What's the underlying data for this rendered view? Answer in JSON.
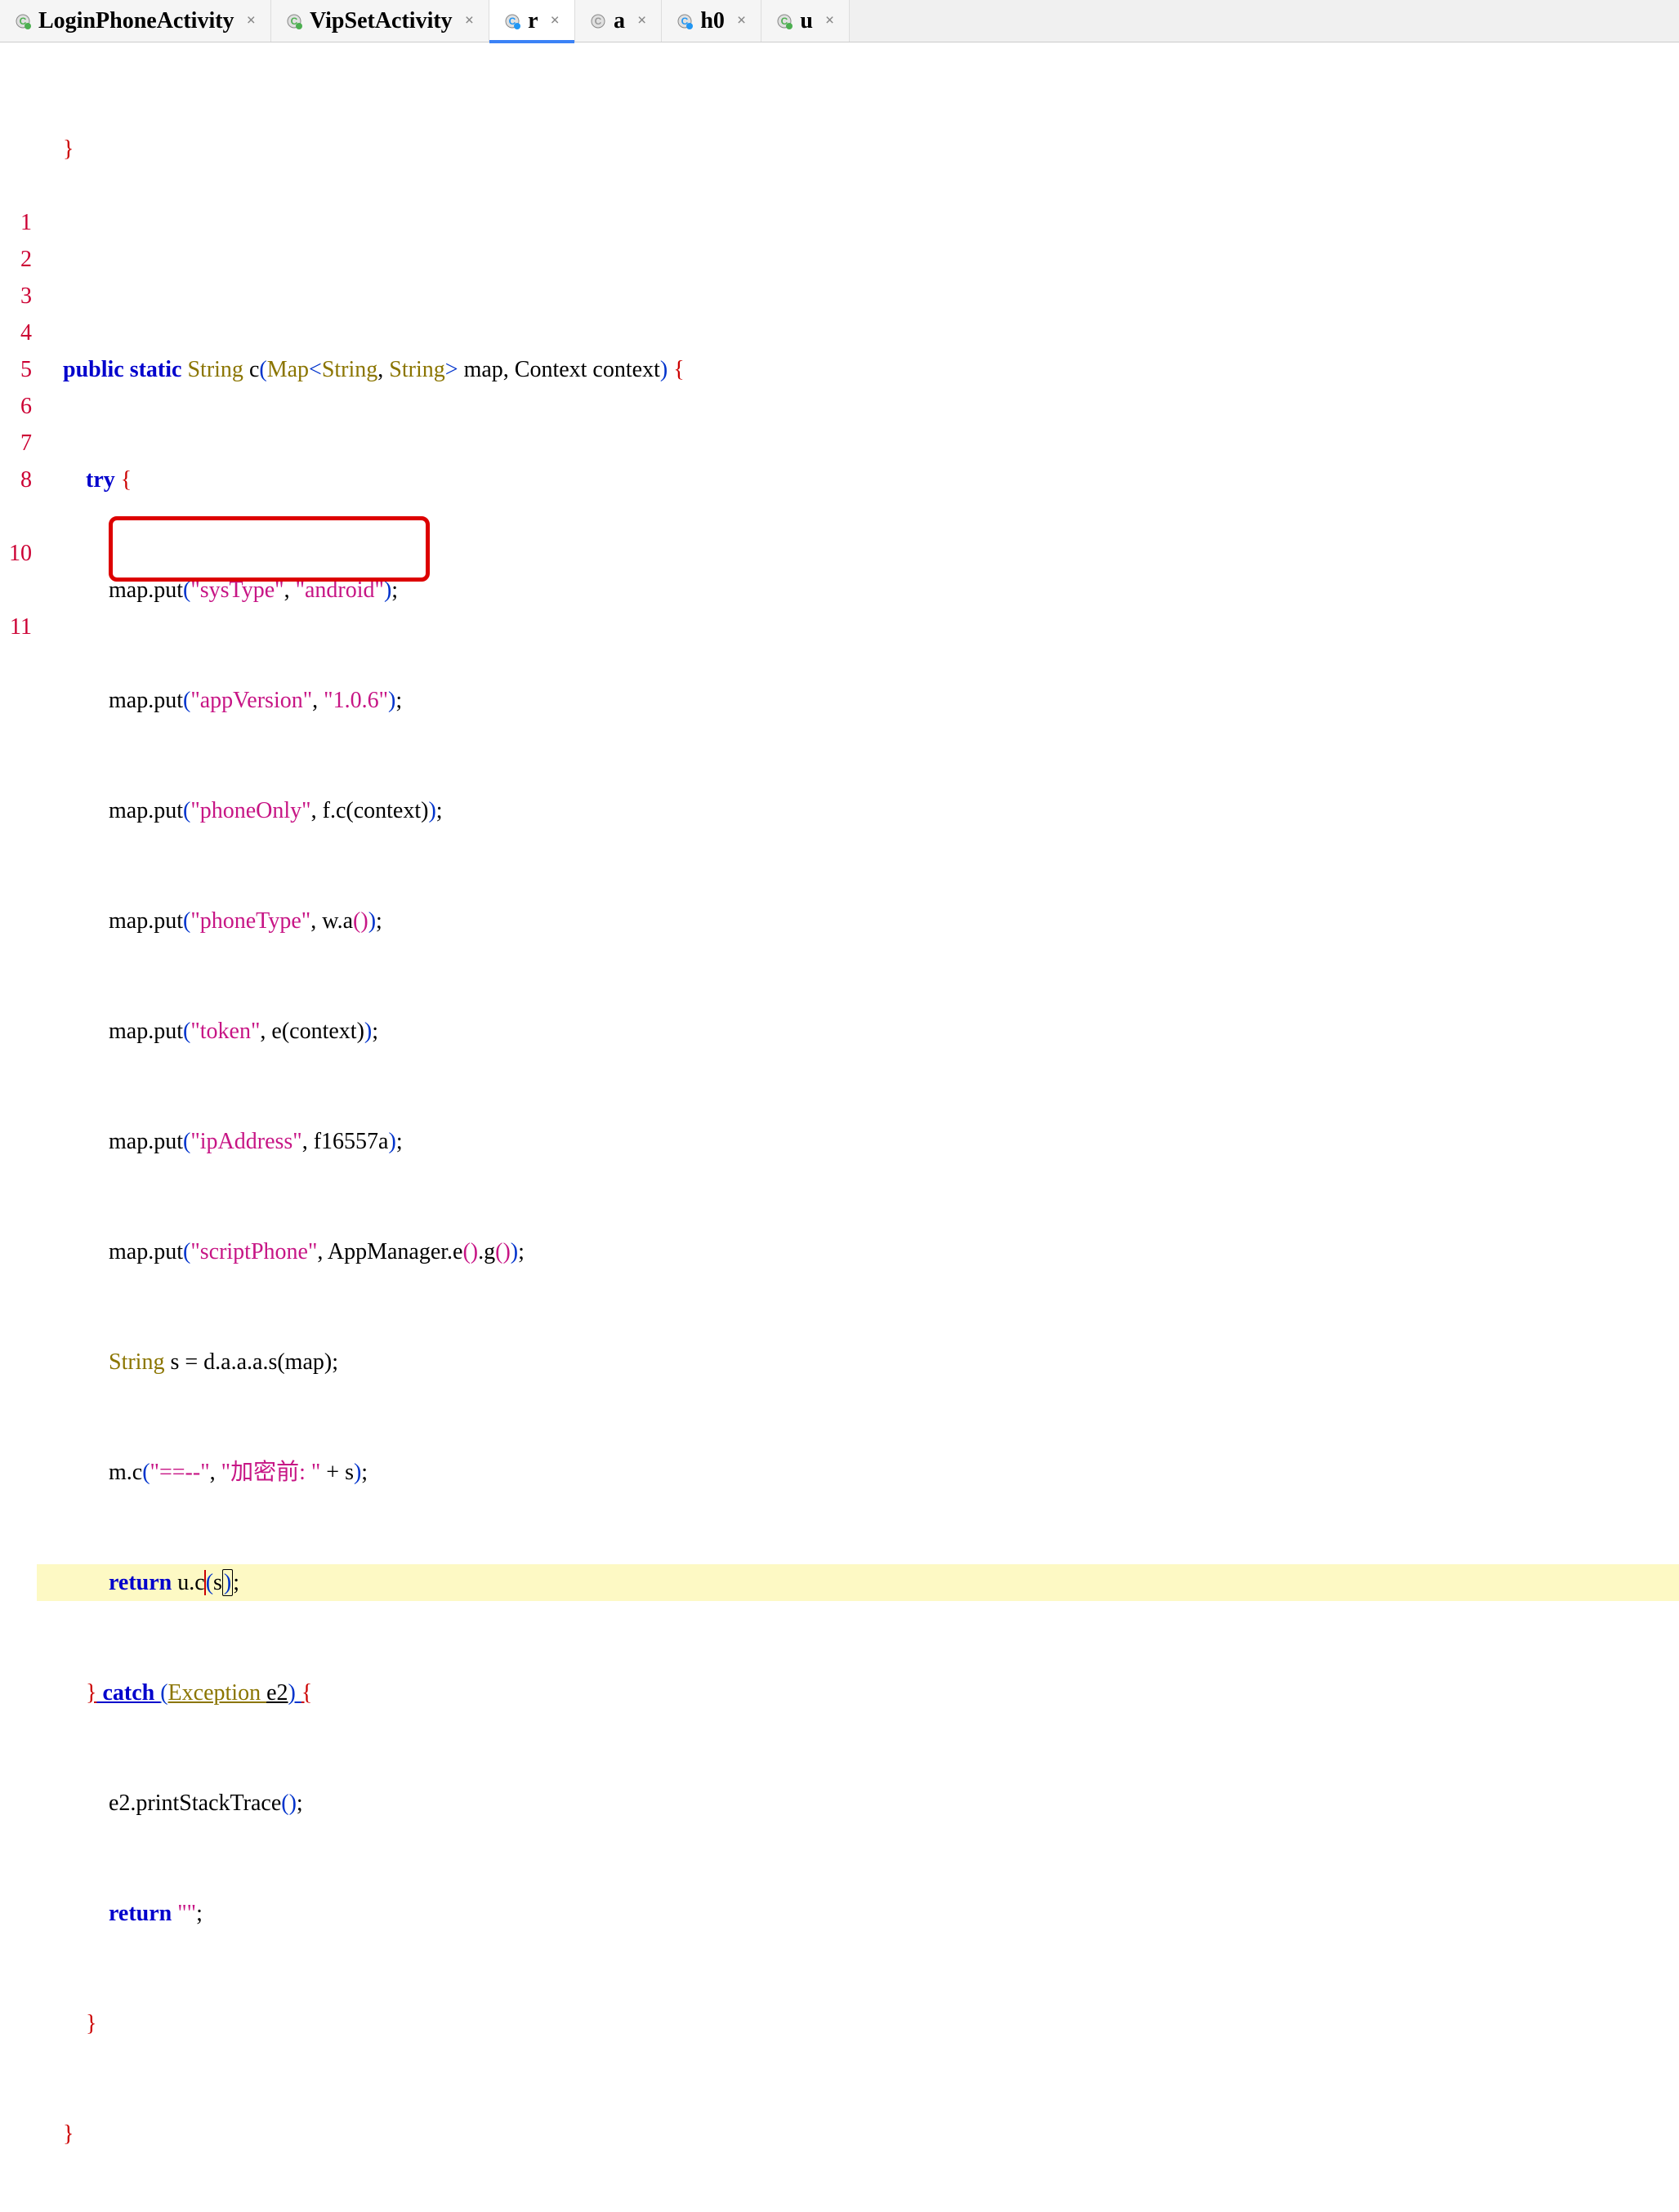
{
  "tabs": [
    {
      "label": "LoginPhoneActivity",
      "iconColor": "#4caf50",
      "iconLetter": "C"
    },
    {
      "label": "VipSetActivity",
      "iconColor": "#4caf50",
      "iconLetter": "C"
    },
    {
      "label": "r",
      "iconColor": "#2196f3",
      "iconLetter": "C",
      "active": true
    },
    {
      "label": "a",
      "iconColor": "#999999",
      "iconLetter": "C"
    },
    {
      "label": "h0",
      "iconColor": "#2196f3",
      "iconLetter": "C"
    },
    {
      "label": "u",
      "iconColor": "#4caf50",
      "iconLetter": "C"
    }
  ],
  "gutter": {
    "blank1": "",
    "n1": "1",
    "n2": "2",
    "n3": "3",
    "n4": "4",
    "n5": "5",
    "n6": "6",
    "n7": "7",
    "n8": "8",
    "n10": "10",
    "n11": "11"
  },
  "code": {
    "closeBrace": "}",
    "sig_public": "public ",
    "sig_static": "static ",
    "sig_type": "String ",
    "sig_name": "c",
    "sig_lp": "(",
    "sig_map": "Map",
    "sig_lt": "<",
    "sig_str1": "String",
    "sig_comma": ", ",
    "sig_str2": "String",
    "sig_gt": "> ",
    "sig_params": "map, Context context",
    "sig_rp": ") ",
    "sig_lb": "{",
    "try_kw": "try ",
    "try_lb": "{",
    "l1_a": "map.put",
    "l1_lp": "(",
    "l1_s1": "\"sysType\"",
    "l1_c": ", ",
    "l1_s2": "\"android\"",
    "l1_rp": ")",
    "l1_semi": ";",
    "l2_a": "map.put",
    "l2_lp": "(",
    "l2_s1": "\"appVersion\"",
    "l2_c": ", ",
    "l2_s2": "\"1.0.6\"",
    "l2_rp": ")",
    "l2_semi": ";",
    "l3_a": "map.put",
    "l3_lp": "(",
    "l3_s1": "\"phoneOnly\"",
    "l3_c": ", f.c(context)",
    "l3_rp": ")",
    "l3_semi": ";",
    "l4_a": "map.put",
    "l4_lp": "(",
    "l4_s1": "\"phoneType\"",
    "l4_c": ", w.a",
    "l4_pp": "()",
    "l4_rp": ")",
    "l4_semi": ";",
    "l5_a": "map.put",
    "l5_lp": "(",
    "l5_s1": "\"token\"",
    "l5_c": ", e(context)",
    "l5_rp": ")",
    "l5_semi": ";",
    "l6_a": "map.put",
    "l6_lp": "(",
    "l6_s1": "\"ipAddress\"",
    "l6_c": ", f16557a",
    "l6_rp": ")",
    "l6_semi": ";",
    "l7_a": "map.put",
    "l7_lp": "(",
    "l7_s1": "\"scriptPhone\"",
    "l7_c": ", AppManager.e",
    "l7_pp1": "()",
    "l7_g": ".g",
    "l7_pp2": "()",
    "l7_rp": ")",
    "l7_semi": ";",
    "l8_type": "String ",
    "l8_rest": "s = d.a.a.a.s(map);",
    "l9_a": "m.c",
    "l9_lp": "(",
    "l9_s1": "\"==--\"",
    "l9_c": ", ",
    "l9_s2": "\"加密前: \"",
    "l9_plus": " + s",
    "l9_rp": ")",
    "l9_semi": ";",
    "ret_kw": "return ",
    "ret_a": "u.c",
    "ret_lp": "(",
    "ret_s": "s",
    "ret_rp": ")",
    "ret_semi": ";",
    "catch_rb": "}",
    "catch_kw": " catch ",
    "catch_lp": "(",
    "catch_exc": "Exception ",
    "catch_var": "e2",
    "catch_rp": ") ",
    "catch_lb": "{",
    "l11_a": "e2.printStackTrace",
    "l11_pp": "()",
    "l11_semi": ";",
    "ret2_kw": "return ",
    "ret2_s": "\"\"",
    "ret2_semi": ";",
    "closeBrace2": "}",
    "closeBrace3": "}"
  }
}
